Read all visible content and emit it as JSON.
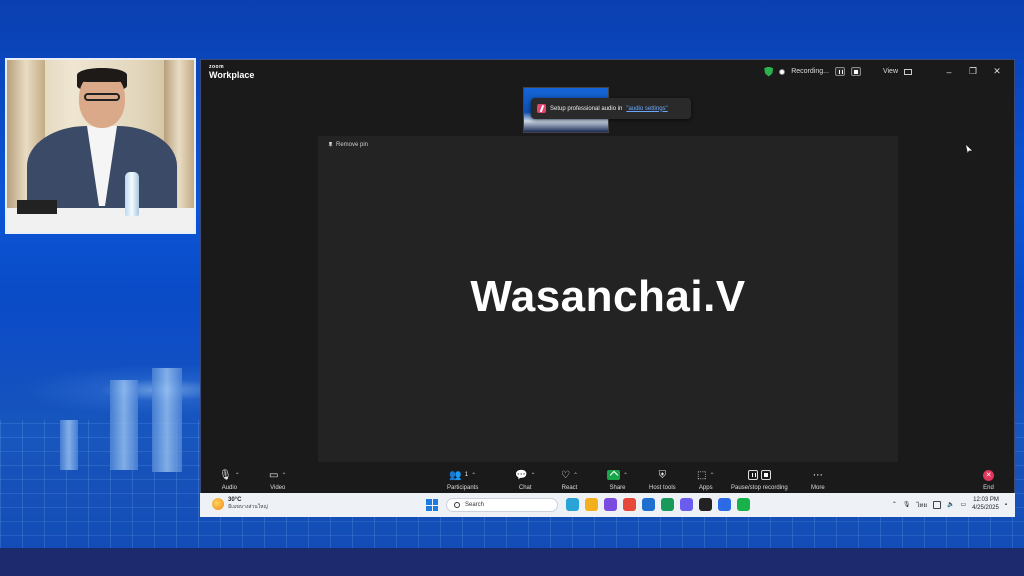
{
  "zoom": {
    "brand_small": "zoom",
    "brand_large": "Workplace",
    "recording_label": "Recording...",
    "view_label": "View",
    "toast": {
      "text": "Setup professional audio in",
      "link": "\"audio settings\""
    },
    "remove_pin": "Remove pin",
    "participant_name": "Wasanchai.V",
    "toolbar": {
      "audio": "Audio",
      "video": "Video",
      "participants": "Participants",
      "participants_count": "1",
      "chat": "Chat",
      "react": "React",
      "share": "Share",
      "host_tools": "Host tools",
      "apps": "Apps",
      "pause_stop_recording": "Pause/stop recording",
      "more": "More",
      "end": "End"
    }
  },
  "taskbar": {
    "temperature": "30°C",
    "weather_desc": "มีเมฆบางส่วนใหญ่",
    "search_label": "Search",
    "language": "ไทย",
    "time": "12:03 PM",
    "date": "4/25/2025",
    "app_colors": [
      "#2aa3d6",
      "#f2b01e",
      "#7b4ce0",
      "#e8483a",
      "#1f6fd1",
      "#1a9a5a",
      "#6b5cf0",
      "#222222",
      "#2b6be6",
      "#17b34a"
    ]
  },
  "colors": {
    "share_green": "#19a64b",
    "end_red": "#e0365b",
    "recording_shield": "#2bb24c",
    "link_blue": "#6aa8ff"
  }
}
